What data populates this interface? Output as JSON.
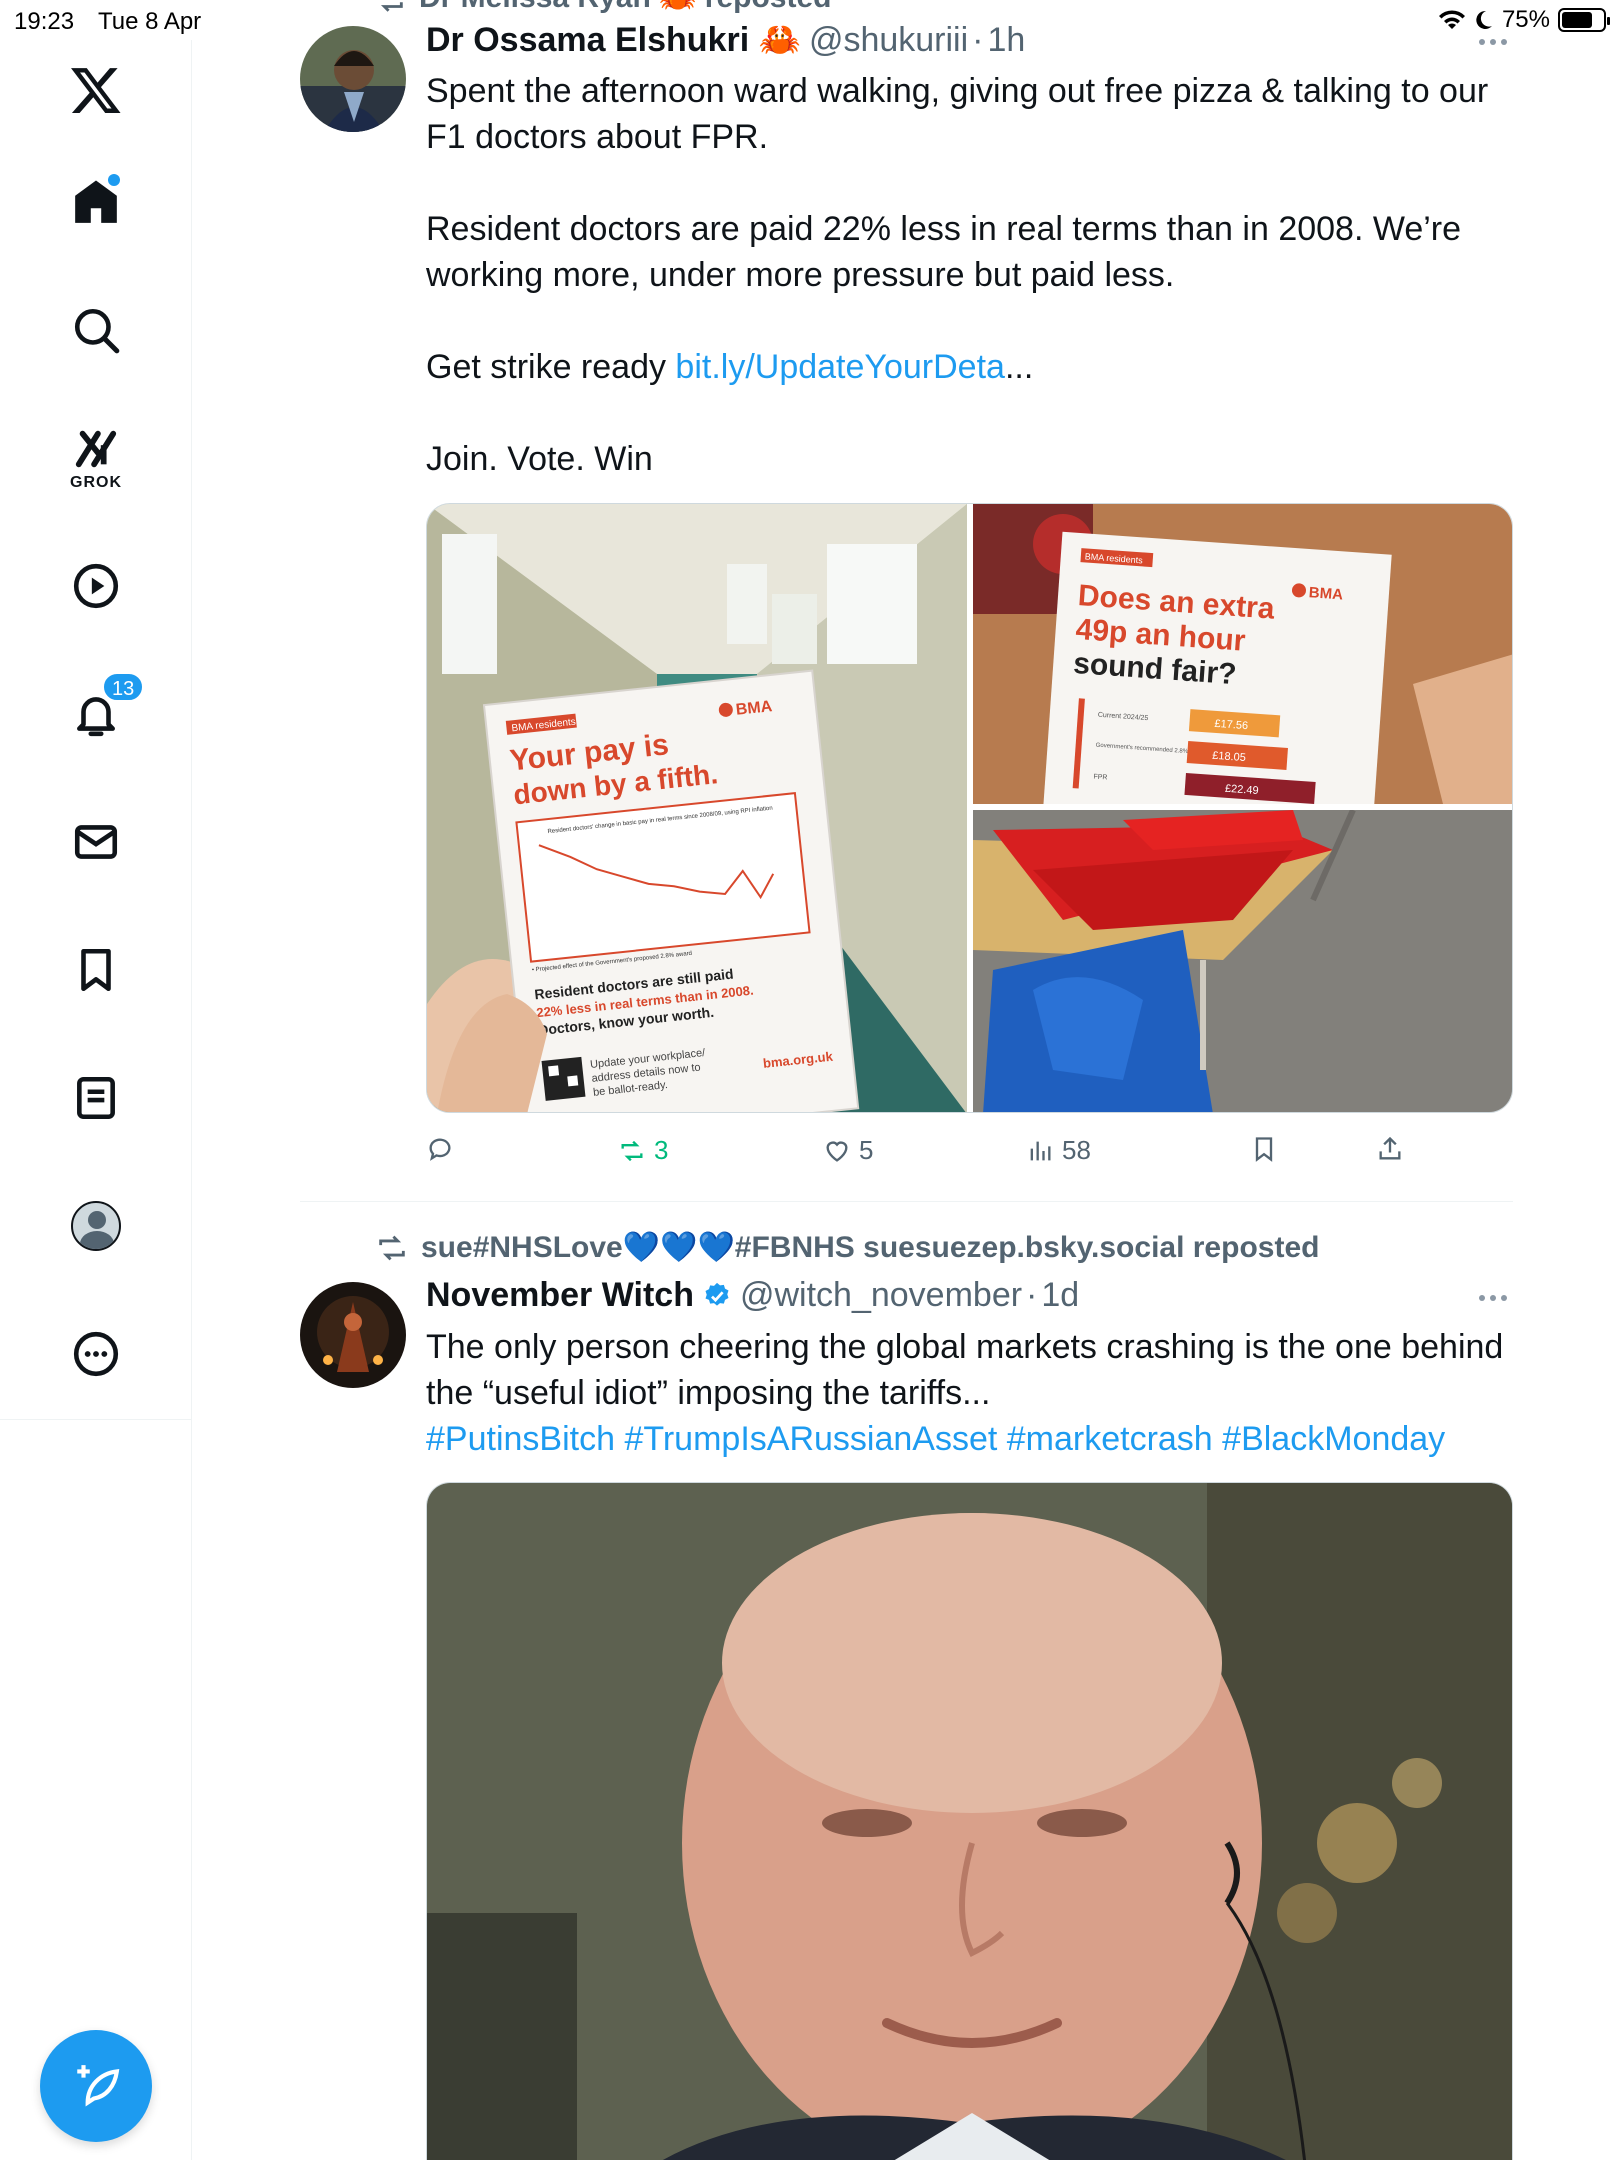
{
  "status_bar": {
    "time": "19:23",
    "date": "Tue 8 Apr",
    "battery": "75%",
    "battery_level": 0.75
  },
  "sidebar": {
    "items": [
      {
        "name": "x-logo-icon"
      },
      {
        "name": "home-icon",
        "has_dot": true
      },
      {
        "name": "search-icon"
      },
      {
        "name": "grok-icon",
        "label": "GROK"
      },
      {
        "name": "video-icon"
      },
      {
        "name": "notifications-icon",
        "badge": "13"
      },
      {
        "name": "messages-icon"
      },
      {
        "name": "bookmarks-icon"
      },
      {
        "name": "lists-icon"
      },
      {
        "name": "profile-icon"
      },
      {
        "name": "more-icon"
      }
    ],
    "compose_icon": "compose-icon"
  },
  "accent_color": "#1d9bf0",
  "tweets": [
    {
      "repost_by": "Dr Melissa Ryan 🦀 reposted",
      "name": "Dr Ossama Elshukri 🦀",
      "handle": "@shukuriii",
      "sep": "·",
      "time": "1h",
      "text_lines": [
        "Spent the afternoon ward walking, giving out free pizza & talking to our",
        "F1 doctors about FPR.",
        "Resident doctors are paid 22% less in real terms than in 2008. We’re",
        "working more, under more pressure but paid less.",
        "Get strike ready ",
        "bit.ly/UpdateYourDeta",
        "...",
        "Join. Vote. Win"
      ],
      "images": {
        "left": {
          "poster_tag": "BMA residents",
          "poster_brand": "BMA",
          "poster_heading_1": "Your pay is",
          "poster_heading_2": "down by a fifth.",
          "poster_chart_title": "Resident doctors' change in basic pay in real terms since 2008/09, using RPI inflation",
          "poster_footnote": "• Projected effect of the Government's proposed 2.8% award",
          "poster_body_1": "Resident doctors are still paid",
          "poster_body_2": "22% less in real terms than in 2008.",
          "poster_body_3": "Doctors, know your worth.",
          "poster_update_1": "Update your workplace/",
          "poster_update_2": "address details now to",
          "poster_update_3": "be ballot-ready.",
          "poster_url": "bma.org.uk"
        },
        "top_right": {
          "tag": "BMA residents",
          "brand": "BMA",
          "heading_1": "Does an extra",
          "heading_2": "49p an hour",
          "heading_3": "sound fair?",
          "bars": [
            {
              "label": "Current 2024/25",
              "value": "£17.56"
            },
            {
              "label": "Government's recommended 2.8% pay award",
              "value": "£18.05"
            },
            {
              "label": "FPR",
              "value": "£22.49"
            }
          ]
        }
      },
      "actions": {
        "replies": "",
        "reposts": "3",
        "likes": "5",
        "views": "58"
      }
    },
    {
      "repost_by": "sue#NHSLove💙💙💙#FBNHS suesuezep.bsky.social reposted",
      "name": "November Witch",
      "handle": "@witch_november",
      "sep": "·",
      "time": "1d",
      "text_lines": [
        "The only person cheering the global markets crashing is the one behind",
        "the “useful idiot” imposing the tariffs...",
        "#PutinsBitch #TrumpIsARussianAsset #marketcrash #BlackMonday"
      ]
    }
  ]
}
